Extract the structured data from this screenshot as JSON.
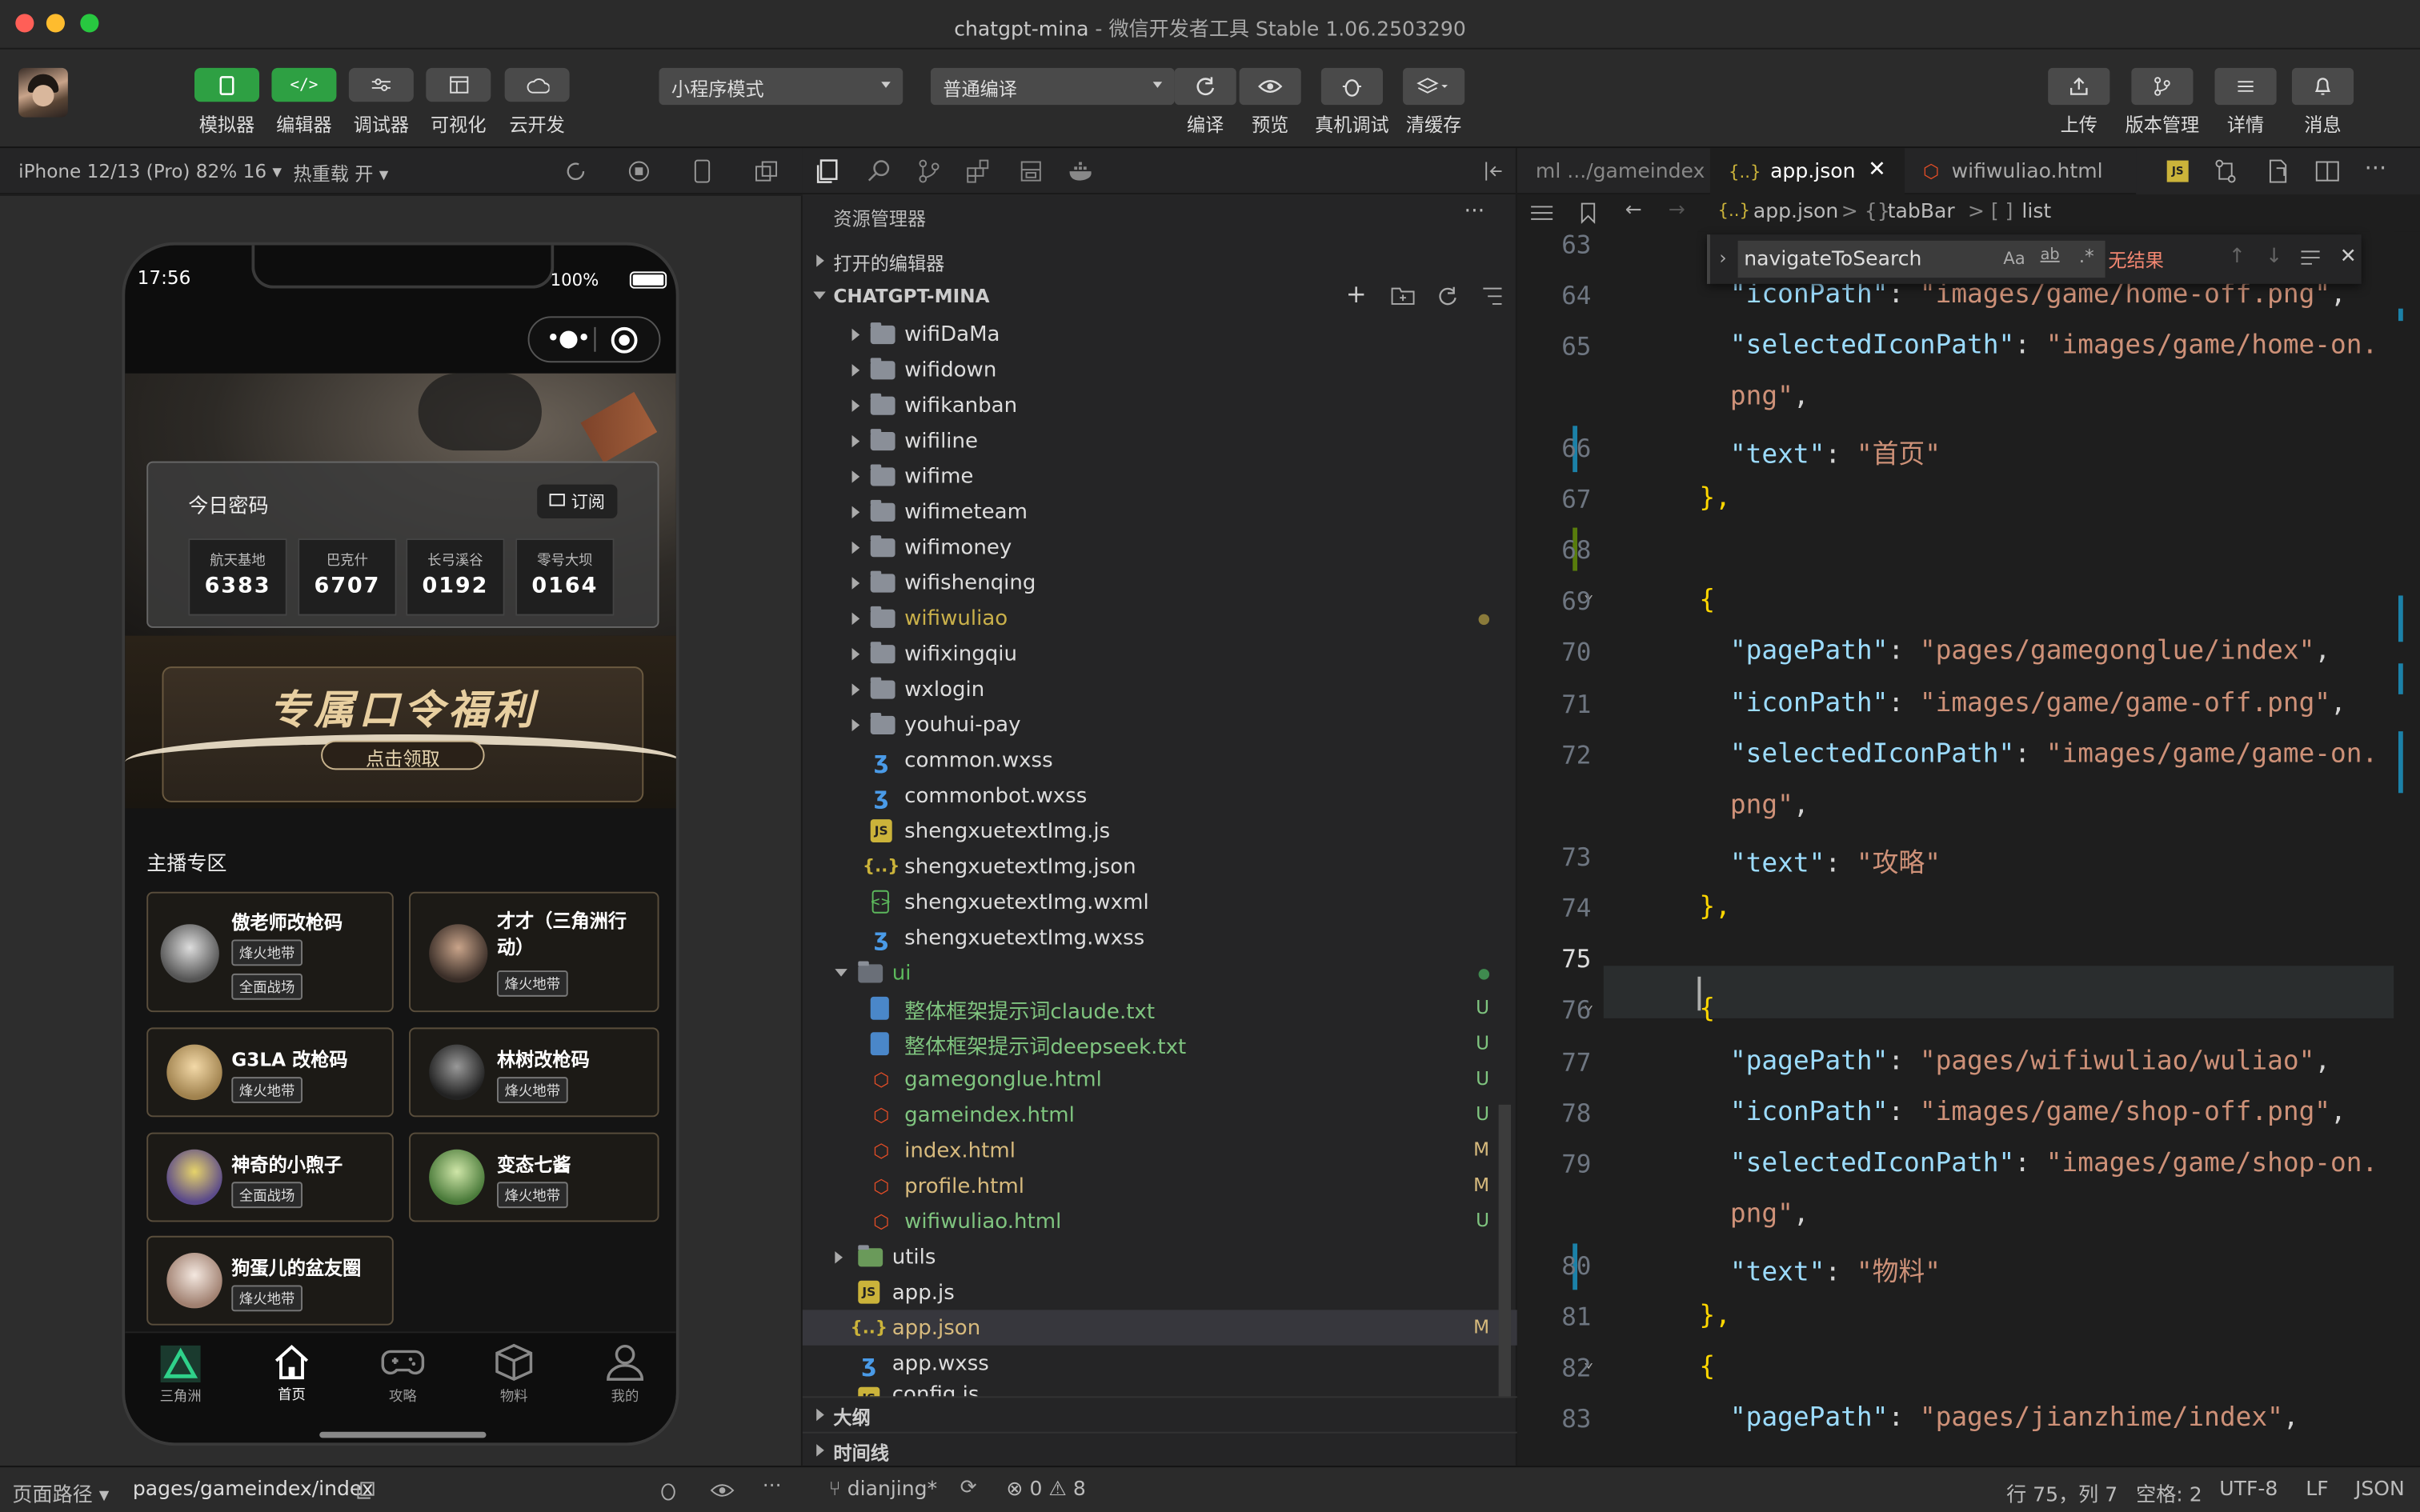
{
  "window": {
    "title": "chatgpt-mina",
    "subtitle": "微信开发者工具 Stable 1.06.2503290",
    "traffic_colors": [
      "#ff5f57",
      "#febc2e",
      "#28c840"
    ]
  },
  "toolbar": {
    "left_buttons": [
      "模拟器",
      "编辑器",
      "调试器",
      "可视化",
      "云开发"
    ],
    "mode_select": "小程序模式",
    "compile_select": "普通编译",
    "mid_buttons": [
      "编译",
      "预览",
      "真机调试",
      "清缓存"
    ],
    "right_buttons": [
      "上传",
      "版本管理",
      "详情",
      "消息"
    ]
  },
  "sim": {
    "device": "iPhone 12/13 (Pro) 82% 16",
    "hot_reload": "热重载 开",
    "time": "17:56",
    "battery": "100%",
    "pwd_title": "今日密码",
    "subscribe": "订阅",
    "codes": [
      {
        "name": "航天基地",
        "code": "6383"
      },
      {
        "name": "巴克什",
        "code": "6707"
      },
      {
        "name": "长弓溪谷",
        "code": "0192"
      },
      {
        "name": "零号大坝",
        "code": "0164"
      }
    ],
    "banner_title": "专属口令福利",
    "banner_btn": "点击领取",
    "section_title": "主播专区",
    "streamers": [
      {
        "name": "傲老师改枪码",
        "tags": [
          "烽火地带",
          "全面战场"
        ]
      },
      {
        "name": "才才（三角洲行动）",
        "tags": [
          "烽火地带"
        ]
      },
      {
        "name": "G3LA 改枪码",
        "tags": [
          "烽火地带"
        ]
      },
      {
        "name": "林树改枪码",
        "tags": [
          "烽火地带"
        ]
      },
      {
        "name": "神奇的小煦子",
        "tags": [
          "全面战场"
        ]
      },
      {
        "name": "变态七酱",
        "tags": [
          "烽火地带"
        ]
      },
      {
        "name": "狗蛋儿的盆友圈",
        "tags": [
          "烽火地带"
        ]
      }
    ],
    "tabbar": [
      "三角洲",
      "首页",
      "攻略",
      "物料",
      "我的"
    ]
  },
  "explorer": {
    "title": "资源管理器",
    "open_editors": "打开的编辑器",
    "project": "CHATGPT-MINA",
    "items": [
      {
        "type": "folder",
        "name": "wifiDaMa"
      },
      {
        "type": "folder",
        "name": "wifidown"
      },
      {
        "type": "folder",
        "name": "wifikanban"
      },
      {
        "type": "folder",
        "name": "wifiline"
      },
      {
        "type": "folder",
        "name": "wifime"
      },
      {
        "type": "folder",
        "name": "wifimeteam"
      },
      {
        "type": "folder",
        "name": "wifimoney"
      },
      {
        "type": "folder",
        "name": "wifishenqing"
      },
      {
        "type": "folder",
        "name": "wifiwuliao",
        "status": "dot"
      },
      {
        "type": "folder",
        "name": "wifixingqiu"
      },
      {
        "type": "folder",
        "name": "wxlogin"
      },
      {
        "type": "folder",
        "name": "youhui-pay"
      },
      {
        "type": "wxss",
        "name": "common.wxss"
      },
      {
        "type": "wxss",
        "name": "commonbot.wxss"
      },
      {
        "type": "js",
        "name": "shengxuetextImg.js"
      },
      {
        "type": "json",
        "name": "shengxuetextImg.json"
      },
      {
        "type": "wxml",
        "name": "shengxuetextImg.wxml"
      },
      {
        "type": "wxss",
        "name": "shengxuetextImg.wxss"
      },
      {
        "type": "folder-open",
        "name": "ui",
        "status": "dot-green"
      },
      {
        "type": "txt",
        "name": "整体框架提示词claude.txt",
        "status": "U"
      },
      {
        "type": "txt",
        "name": "整体框架提示词deepseek.txt",
        "status": "U"
      },
      {
        "type": "html",
        "name": "gamegonglue.html",
        "status": "U"
      },
      {
        "type": "html",
        "name": "gameindex.html",
        "status": "U"
      },
      {
        "type": "html",
        "name": "index.html",
        "status": "M"
      },
      {
        "type": "html",
        "name": "profile.html",
        "status": "M"
      },
      {
        "type": "html",
        "name": "wifiwuliao.html",
        "status": "U"
      },
      {
        "type": "folder-util",
        "name": "utils"
      },
      {
        "type": "js",
        "name": "app.js"
      },
      {
        "type": "json",
        "name": "app.json",
        "status": "M"
      },
      {
        "type": "wxss",
        "name": "app.wxss"
      },
      {
        "type": "js",
        "name": "config.js"
      }
    ],
    "outline": "大纲",
    "timeline": "时间线"
  },
  "editor": {
    "tabs": [
      "ml .../gameindex",
      "app.json",
      "wifiwuliao.html"
    ],
    "breadcrumb": [
      "app.json",
      "tabBar",
      "list"
    ],
    "find_query": "navigateToSearch",
    "find_result": "无结果",
    "lines": [
      {
        "n": "63",
        "t": ""
      },
      {
        "n": "64",
        "k": "\"iconPath\"",
        "v": "\"images/game/home-off.png\"",
        "e": ","
      },
      {
        "n": "65",
        "k": "\"selectedIconPath\"",
        "v": "\"images/game/home-on.",
        "e": ""
      },
      {
        "n": "",
        "v": "png\"",
        "e": ","
      },
      {
        "n": "66",
        "k": "\"text\"",
        "v": "\"首页\"",
        "e": ""
      },
      {
        "n": "67",
        "b": "},"
      },
      {
        "n": "68",
        "t": ""
      },
      {
        "n": "69",
        "b": "{"
      },
      {
        "n": "70",
        "k": "\"pagePath\"",
        "v": "\"pages/gamegonglue/index\"",
        "e": ","
      },
      {
        "n": "71",
        "k": "\"iconPath\"",
        "v": "\"images/game/game-off.png\"",
        "e": ","
      },
      {
        "n": "72",
        "k": "\"selectedIconPath\"",
        "v": "\"images/game/game-on.",
        "e": ""
      },
      {
        "n": "",
        "v": "png\"",
        "e": ","
      },
      {
        "n": "73",
        "k": "\"text\"",
        "v": "\"攻略\"",
        "e": ""
      },
      {
        "n": "74",
        "b": "},"
      },
      {
        "n": "75",
        "t": ""
      },
      {
        "n": "76",
        "b": "{"
      },
      {
        "n": "77",
        "k": "\"pagePath\"",
        "v": "\"pages/wifiwuliao/wuliao\"",
        "e": ","
      },
      {
        "n": "78",
        "k": "\"iconPath\"",
        "v": "\"images/game/shop-off.png\"",
        "e": ","
      },
      {
        "n": "79",
        "k": "\"selectedIconPath\"",
        "v": "\"images/game/shop-on.",
        "e": ""
      },
      {
        "n": "",
        "v": "png\"",
        "e": ","
      },
      {
        "n": "80",
        "k": "\"text\"",
        "v": "\"物料\"",
        "e": ""
      },
      {
        "n": "81",
        "b": "},"
      },
      {
        "n": "82",
        "b": "{"
      },
      {
        "n": "83",
        "k": "\"pagePath\"",
        "v": "\"pages/jianzhime/index\"",
        "e": ","
      }
    ]
  },
  "status": {
    "page_path_label": "页面路径",
    "page_path": "pages/gameindex/index",
    "branch": "dianjing*",
    "errors": "0",
    "warnings": "8",
    "cursor": "行 75，列 7",
    "indent": "空格: 2",
    "encoding": "UTF-8",
    "eol": "LF",
    "lang": "JSON"
  }
}
